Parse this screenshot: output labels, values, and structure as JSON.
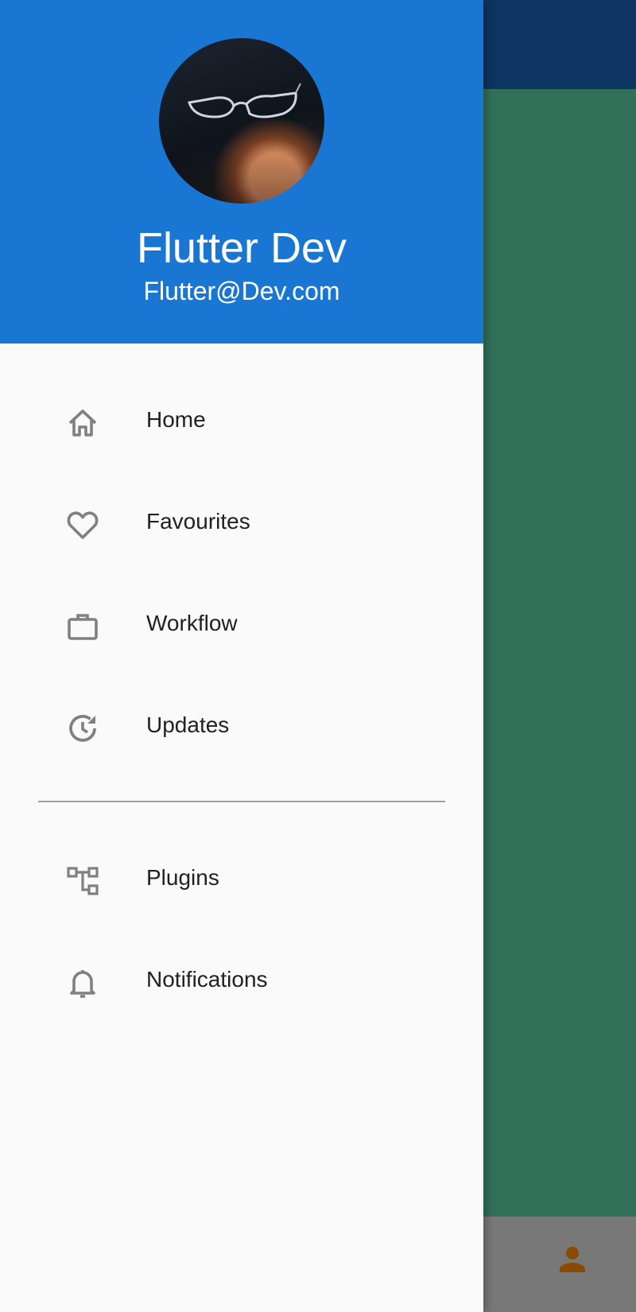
{
  "app": {
    "colors": {
      "drawer_header": "#1976d3",
      "drawer_bg": "#fafafa",
      "app_bar_dimmed": "#0e3561",
      "body_dimmed": "#32705a",
      "bottom_bar_dimmed": "#787878",
      "person_icon_dimmed": "#8a4a00",
      "icon_grey": "#808080",
      "text_dark": "#212121"
    }
  },
  "drawer": {
    "header": {
      "name": "Flutter Dev",
      "email": "Flutter@Dev.com",
      "avatar_icon": "profile-photo"
    },
    "items": [
      {
        "label": "Home",
        "icon": "home-icon"
      },
      {
        "label": "Favourites",
        "icon": "heart-icon"
      },
      {
        "label": "Workflow",
        "icon": "briefcase-icon"
      },
      {
        "label": "Updates",
        "icon": "update-history-icon"
      }
    ],
    "secondary_items": [
      {
        "label": "Plugins",
        "icon": "account-tree-icon"
      },
      {
        "label": "Notifications",
        "icon": "bell-icon"
      }
    ]
  },
  "bottom_bar": {
    "person_icon": "person-icon"
  }
}
